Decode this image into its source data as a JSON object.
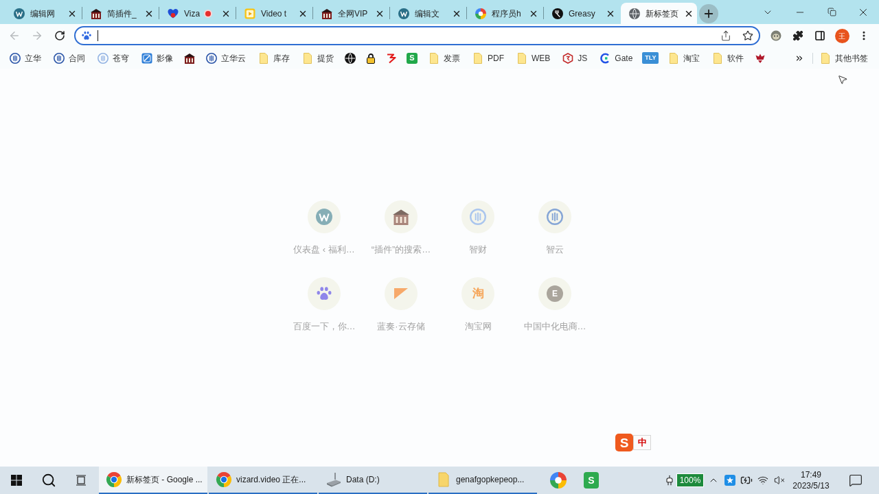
{
  "tabs": [
    {
      "title": "编辑网",
      "kind": "wp",
      "recording": false,
      "selected": false
    },
    {
      "title": "简插件_",
      "kind": "house",
      "recording": false,
      "selected": false
    },
    {
      "title": "Viza",
      "kind": "heart",
      "recording": true,
      "selected": false
    },
    {
      "title": "Video t",
      "kind": "video",
      "recording": false,
      "selected": false
    },
    {
      "title": "全网VIP",
      "kind": "house",
      "recording": false,
      "selected": false
    },
    {
      "title": "编辑文",
      "kind": "wp",
      "recording": false,
      "selected": false
    },
    {
      "title": "程序员h",
      "kind": "pinwheel",
      "recording": false,
      "selected": false
    },
    {
      "title": "Greasy",
      "kind": "fork",
      "recording": false,
      "selected": false
    },
    {
      "title": "新标签页",
      "kind": "globe",
      "recording": false,
      "selected": true
    }
  ],
  "nav": {
    "back": {
      "disabled": true
    },
    "forward": {
      "disabled": true
    }
  },
  "address_bar": {
    "focused": true
  },
  "profile": {
    "initial": "王"
  },
  "bookmarks": [
    {
      "kind": "ring",
      "label": "立华"
    },
    {
      "kind": "ring",
      "label": "合同"
    },
    {
      "kind": "ringlight",
      "label": "苍穹"
    },
    {
      "kind": "tile",
      "label": "影像"
    },
    {
      "kind": "house"
    },
    {
      "kind": "ring",
      "label": "立华云"
    },
    {
      "kind": "folder",
      "label": "库存"
    },
    {
      "kind": "folder",
      "label": "提货"
    },
    {
      "kind": "globe"
    },
    {
      "kind": "lock"
    },
    {
      "kind": "zigzag"
    },
    {
      "kind": "sheet",
      "glyph": "S"
    },
    {
      "kind": "folder",
      "label": "发票"
    },
    {
      "kind": "folder",
      "label": "PDF"
    },
    {
      "kind": "folder",
      "label": "WEB"
    },
    {
      "kind": "hexagon",
      "label": "JS"
    },
    {
      "kind": "gate",
      "label": "Gate"
    },
    {
      "kind": "badge",
      "glyph": "TLY"
    },
    {
      "kind": "folder",
      "label": "淘宝"
    },
    {
      "kind": "folder",
      "label": "软件"
    },
    {
      "kind": "crown"
    }
  ],
  "other_bookmarks": {
    "label": "其他书签"
  },
  "shortcuts": [
    {
      "title": "仪表盘 ‹ 福利…",
      "kind": "wp"
    },
    {
      "title": "“插件”的搜索…",
      "kind": "house"
    },
    {
      "title": "智财",
      "kind": "ringlight"
    },
    {
      "title": "智云",
      "kind": "ring"
    },
    {
      "title": "百度一下，你…",
      "kind": "paw"
    },
    {
      "title": "蓝奏·云存储",
      "kind": "wedge"
    },
    {
      "title": "淘宝网",
      "kind": "letter",
      "glyph": "淘"
    },
    {
      "title": "中国中化电商…",
      "kind": "disc",
      "glyph": "E"
    }
  ],
  "ime": {
    "logo": "S",
    "mode": "中"
  },
  "taskbar": {
    "windows": [
      {
        "kind": "chrome",
        "title": "新标签页 - Google ...",
        "selected": true
      },
      {
        "kind": "chrome",
        "title": "vizard.video 正在...",
        "selected": false
      },
      {
        "kind": "drive",
        "title": "Data (D:)",
        "selected": false
      },
      {
        "kind": "folder",
        "title": "genafgopkepeop...",
        "selected": false
      }
    ],
    "pinned": [
      {
        "kind": "pinwheel"
      },
      {
        "kind": "sheet",
        "glyph": "S"
      }
    ],
    "battery": "100%",
    "time": "17:49",
    "date": "2023/5/13"
  }
}
